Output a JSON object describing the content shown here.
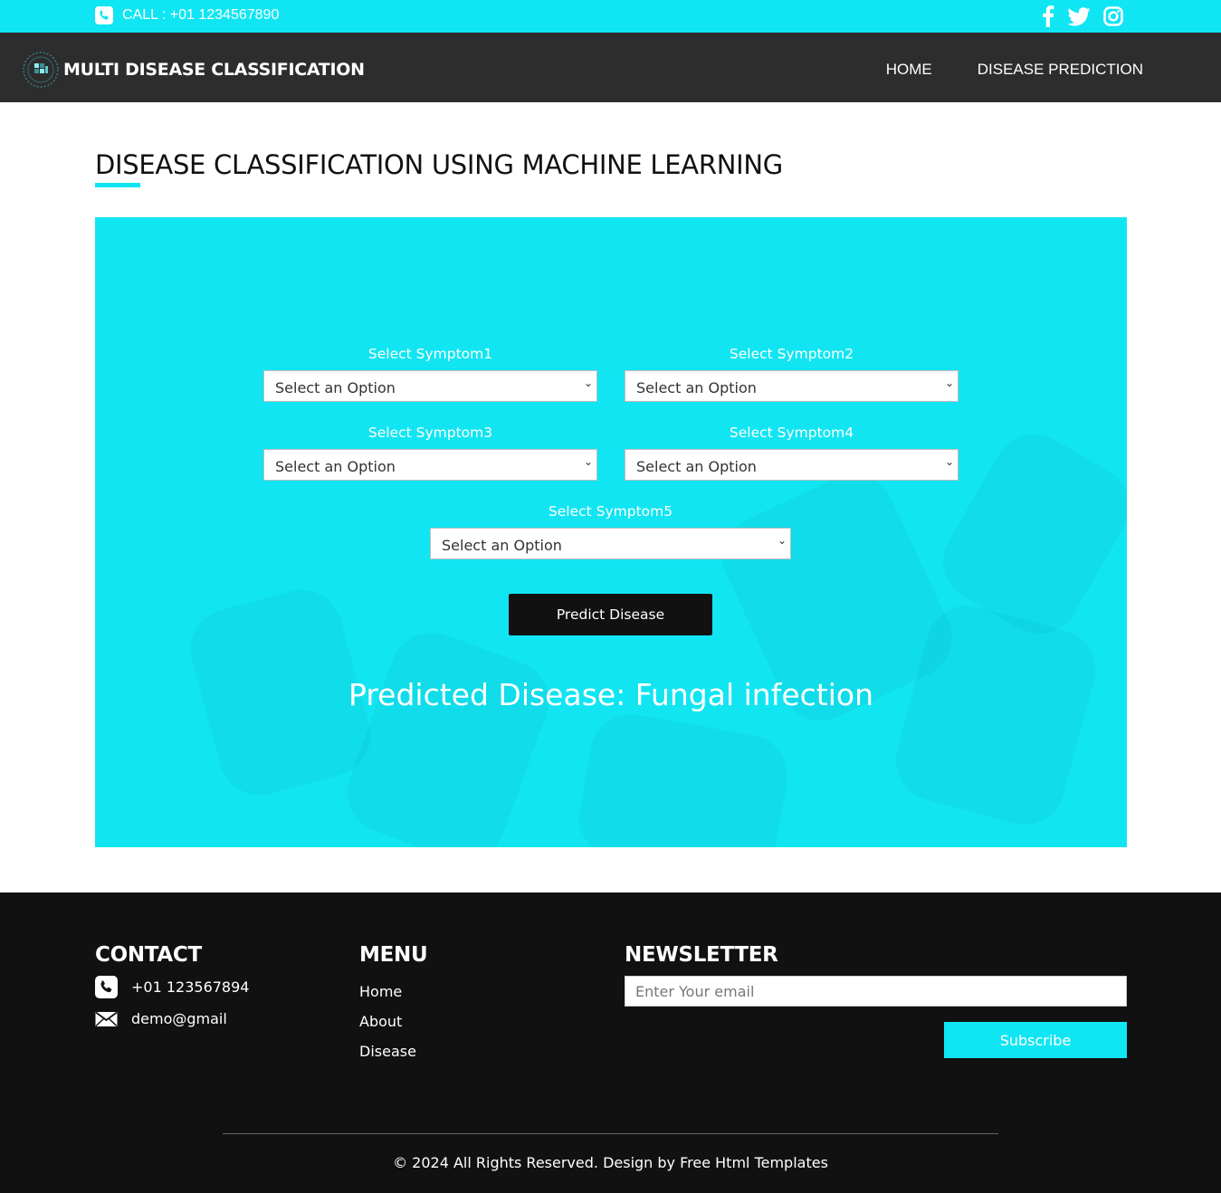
{
  "topbar": {
    "call_text": "CALL : +01 1234567890",
    "social": [
      "facebook-icon",
      "twitter-icon",
      "instagram-icon"
    ]
  },
  "nav": {
    "brand": "MULTI DISEASE CLASSIFICATION",
    "items": [
      "HOME",
      "DISEASE PREDICTION"
    ]
  },
  "page": {
    "heading": "DISEASE CLASSIFICATION USING MACHINE LEARNING"
  },
  "form": {
    "fields": [
      {
        "label": "Select Symptom1",
        "value": "Select an Option"
      },
      {
        "label": "Select Symptom2",
        "value": "Select an Option"
      },
      {
        "label": "Select Symptom3",
        "value": "Select an Option"
      },
      {
        "label": "Select Symptom4",
        "value": "Select an Option"
      },
      {
        "label": "Select Symptom5",
        "value": "Select an Option"
      }
    ],
    "button": "Predict Disease",
    "result": "Predicted Disease: Fungal infection"
  },
  "footer": {
    "contact_title": "CONTACT",
    "phone": "+01 123567894",
    "email": "demo@gmail",
    "menu_title": "MENU",
    "menu_items": [
      "Home",
      "About",
      "Disease"
    ],
    "newsletter_title": "NEWSLETTER",
    "email_placeholder": "Enter Your email",
    "subscribe": "Subscribe",
    "copyright": "© 2024 All Rights Reserved. Design by Free Html Templates"
  },
  "colors": {
    "accent": "#10e6f3",
    "nav_bg": "#2d2d2d",
    "footer_bg": "#111111"
  }
}
